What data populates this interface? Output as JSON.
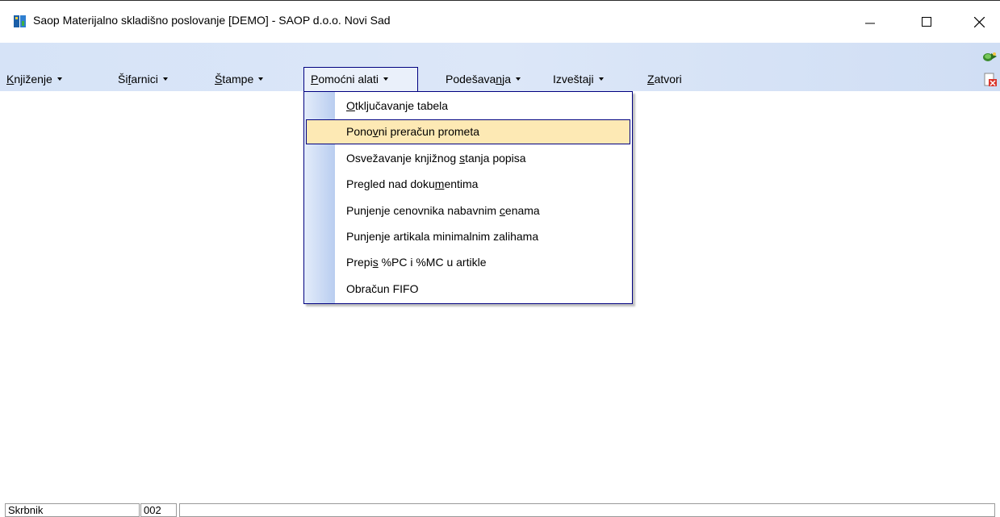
{
  "window": {
    "title": "Saop  Materijalno skladišno poslovanje [DEMO] - SAOP d.o.o. Novi Sad",
    "icon": "saop-app-icon",
    "minimize_icon": "minimize-icon",
    "maximize_icon": "maximize-icon",
    "close_icon": "close-icon"
  },
  "menu": {
    "items": [
      {
        "pre": "",
        "u": "K",
        "post": "njiženje",
        "arrow": true
      },
      {
        "pre": "Ši",
        "u": "f",
        "post": "arnici",
        "arrow": true
      },
      {
        "pre": "",
        "u": "Š",
        "post": "tampe",
        "arrow": true
      },
      {
        "pre": "",
        "u": "P",
        "post": "omoćni alati",
        "arrow": true
      },
      {
        "pre": "Podešava",
        "u": "n",
        "post": "ja",
        "arrow": true
      },
      {
        "pre": "Izveštaji",
        "u": "",
        "post": "",
        "arrow": true
      },
      {
        "pre": "",
        "u": "Z",
        "post": "atvori",
        "arrow": false
      }
    ],
    "right_icons": [
      "refresh-icon",
      "close-document-icon"
    ]
  },
  "dropdown": {
    "items": [
      {
        "pre": "",
        "u": "O",
        "post": "tključavanje tabela"
      },
      {
        "pre": "Pono",
        "u": "v",
        "post": "ni preračun prometa"
      },
      {
        "pre": "Osvežavanje knjižnog ",
        "u": "s",
        "post": "tanja popisa"
      },
      {
        "pre": "Pregled nad doku",
        "u": "m",
        "post": "entima"
      },
      {
        "pre": "Punjenje cenovnika nabavnim ",
        "u": "c",
        "post": "enama"
      },
      {
        "pre": "Punjenje artikala minimalnim zalihama",
        "u": "",
        "post": ""
      },
      {
        "pre": "Prepi",
        "u": "s",
        "post": " %PC i %MC u artikle"
      },
      {
        "pre": "Obračun FIFO",
        "u": "",
        "post": ""
      }
    ],
    "highlighted_index": 1,
    "highlight_color": "#fde9b4",
    "border_color": "#000080"
  },
  "status": {
    "user": "Skrbnik",
    "code": "002",
    "message": ""
  }
}
